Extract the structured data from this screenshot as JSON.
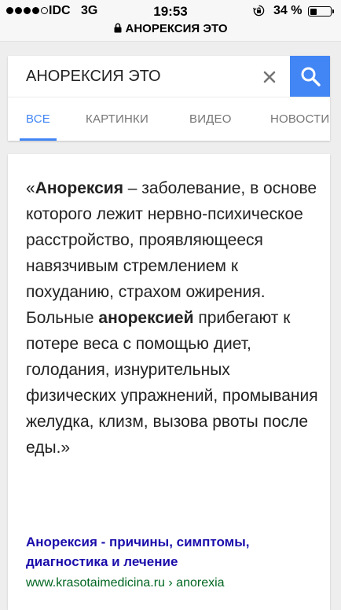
{
  "status_bar": {
    "carrier": "IDC",
    "network": "3G",
    "time": "19:53",
    "battery": "34 %",
    "battery_level": 0.34,
    "signal_bars_filled": 4,
    "signal_bars_total": 5,
    "url_text": "АНОРЕКСИЯ ЭТО",
    "icons": [
      "lock-icon",
      "rotation-lock-icon",
      "battery-icon",
      "signal-dots-icon"
    ]
  },
  "search": {
    "query": "АНОРЕКСИЯ ЭТО",
    "accent_color": "#4285f4",
    "icons": [
      "clear-icon",
      "search-icon"
    ]
  },
  "tabs": [
    {
      "label": "ВСЕ",
      "active": true
    },
    {
      "label": "КАРТИНКИ",
      "active": false
    },
    {
      "label": "ВИДЕО",
      "active": false
    },
    {
      "label": "НОВОСТИ",
      "active": false
    }
  ],
  "answer": {
    "open_quote": "«",
    "term1": "Анорексия",
    "text1": " – заболевание, в основе которого лежит нервно-психическое расстройство, проявляющееся навязчивым стремлением к похуданию, страхом ожирения. Больные ",
    "term2": "анорексией",
    "text2": " прибегают к потере веса с помощью диет, голодания, изнурительных физических упражнений, промывания желудка, клизм, вызова рвоты после еды.»",
    "result_title": "Анорексия - причины, симптомы, диагностика и лечение",
    "result_url": "www.krasotaimedicina.ru › anorexia",
    "title_color": "#1a0dab",
    "url_color": "#006621"
  }
}
